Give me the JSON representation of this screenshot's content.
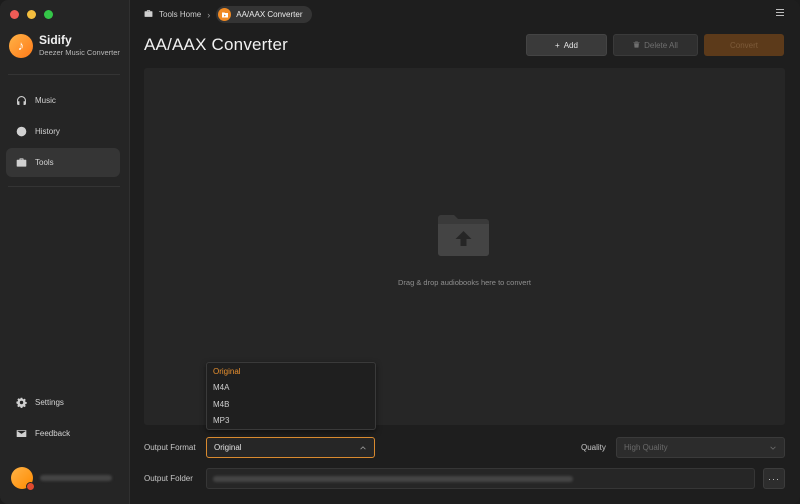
{
  "brand": {
    "name": "Sidify",
    "subtitle": "Deezer Music Converter"
  },
  "nav": {
    "music": "Music",
    "history": "History",
    "tools": "Tools",
    "settings": "Settings",
    "feedback": "Feedback"
  },
  "breadcrumb": {
    "home": "Tools Home",
    "current": "AA/AAX Converter"
  },
  "page": {
    "title": "AA/AAX Converter"
  },
  "toolbar": {
    "add": "Add",
    "delete_all": "Delete All",
    "convert": "Convert"
  },
  "dropzone": {
    "text": "Drag & drop audiobooks here to convert"
  },
  "output_format": {
    "label": "Output Format",
    "value": "Original",
    "options": [
      "Original",
      "M4A",
      "M4B",
      "MP3"
    ]
  },
  "quality": {
    "label": "Quality",
    "value": "High Quality"
  },
  "output_folder": {
    "label": "Output Folder",
    "browse": "···"
  },
  "colors": {
    "accent": "#e8902f",
    "background": "#1e1e1e",
    "sidebar": "#252525"
  }
}
